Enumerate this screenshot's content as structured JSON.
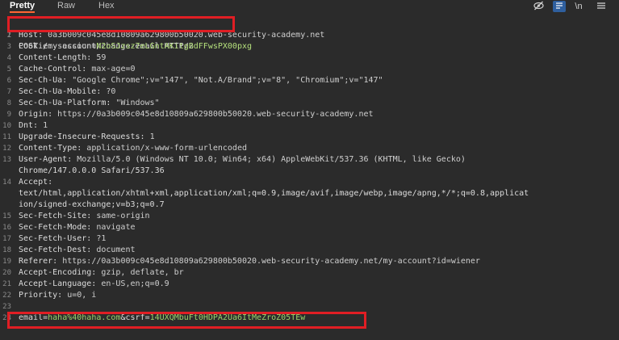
{
  "tabs": [
    {
      "label": "Pretty",
      "active": true
    },
    {
      "label": "Raw",
      "active": false
    },
    {
      "label": "Hex",
      "active": false
    }
  ],
  "toolbar": {
    "eye_icon": "eye-slash-icon",
    "wrap_icon": "wrap-lines-icon",
    "newline_label": "\\n",
    "menu_icon": "hamburger-menu-icon"
  },
  "request_line": "POST /my-account/change-email HTTP/2",
  "headers": [
    {
      "n": "2",
      "name": "Host:",
      "value": " 0a3b009c045e8d10809a629800b50020.web-security-academy.net"
    },
    {
      "n": "3",
      "name": "Cookie:",
      "value": " session=",
      "cookie_value": "N2oSJzsz7eLGntAKitgBdFFwsPX00pxg"
    },
    {
      "n": "4",
      "name": "Content-Length:",
      "value": " 59"
    },
    {
      "n": "5",
      "name": "Cache-Control:",
      "value": " max-age=0"
    },
    {
      "n": "6",
      "name": "Sec-Ch-Ua:",
      "value": " \"Google Chrome\";v=\"147\", \"Not.A/Brand\";v=\"8\", \"Chromium\";v=\"147\""
    },
    {
      "n": "7",
      "name": "Sec-Ch-Ua-Mobile:",
      "value": " ?0"
    },
    {
      "n": "8",
      "name": "Sec-Ch-Ua-Platform:",
      "value": " \"Windows\""
    },
    {
      "n": "9",
      "name": "Origin:",
      "value": " https://0a3b009c045e8d10809a629800b50020.web-security-academy.net"
    },
    {
      "n": "10",
      "name": "Dnt:",
      "value": " 1"
    },
    {
      "n": "11",
      "name": "Upgrade-Insecure-Requests:",
      "value": " 1"
    },
    {
      "n": "12",
      "name": "Content-Type:",
      "value": " application/x-www-form-urlencoded"
    },
    {
      "n": "13",
      "name": "User-Agent:",
      "value": " Mozilla/5.0 (Windows NT 10.0; Win64; x64) AppleWebKit/537.36 (KHTML, like Gecko)",
      "cont": "Chrome/147.0.0.0 Safari/537.36"
    },
    {
      "n": "14",
      "name": "Accept:",
      "value": "",
      "cont": "text/html,application/xhtml+xml,application/xml;q=0.9,image/avif,image/webp,image/apng,*/*;q=0.8,applicat",
      "cont2": "ion/signed-exchange;v=b3;q=0.7"
    },
    {
      "n": "15",
      "name": "Sec-Fetch-Site:",
      "value": " same-origin"
    },
    {
      "n": "16",
      "name": "Sec-Fetch-Mode:",
      "value": " navigate"
    },
    {
      "n": "17",
      "name": "Sec-Fetch-User:",
      "value": " ?1"
    },
    {
      "n": "18",
      "name": "Sec-Fetch-Dest:",
      "value": " document"
    },
    {
      "n": "19",
      "name": "Referer:",
      "value": " https://0a3b009c045e8d10809a629800b50020.web-security-academy.net/my-account?id=wiener"
    },
    {
      "n": "20",
      "name": "Accept-Encoding:",
      "value": " gzip, deflate, br"
    },
    {
      "n": "21",
      "name": "Accept-Language:",
      "value": " en-US,en;q=0.9"
    },
    {
      "n": "22",
      "name": "Priority:",
      "value": " u=0, i"
    }
  ],
  "blank_line_number": "23",
  "body_line_number": "24",
  "body": {
    "email_key": "email",
    "email_value": "haha%40haha.com",
    "csrf_key": "csrf",
    "csrf_value": "14UXQMbuFt0HDPA2Ua6ItMeZroZ05TEw"
  },
  "colors": {
    "highlight": "#e01e24",
    "param_value": "#9bd36b",
    "cookie_value": "#b5e07c",
    "active_tab_underline": "#ff6633"
  }
}
